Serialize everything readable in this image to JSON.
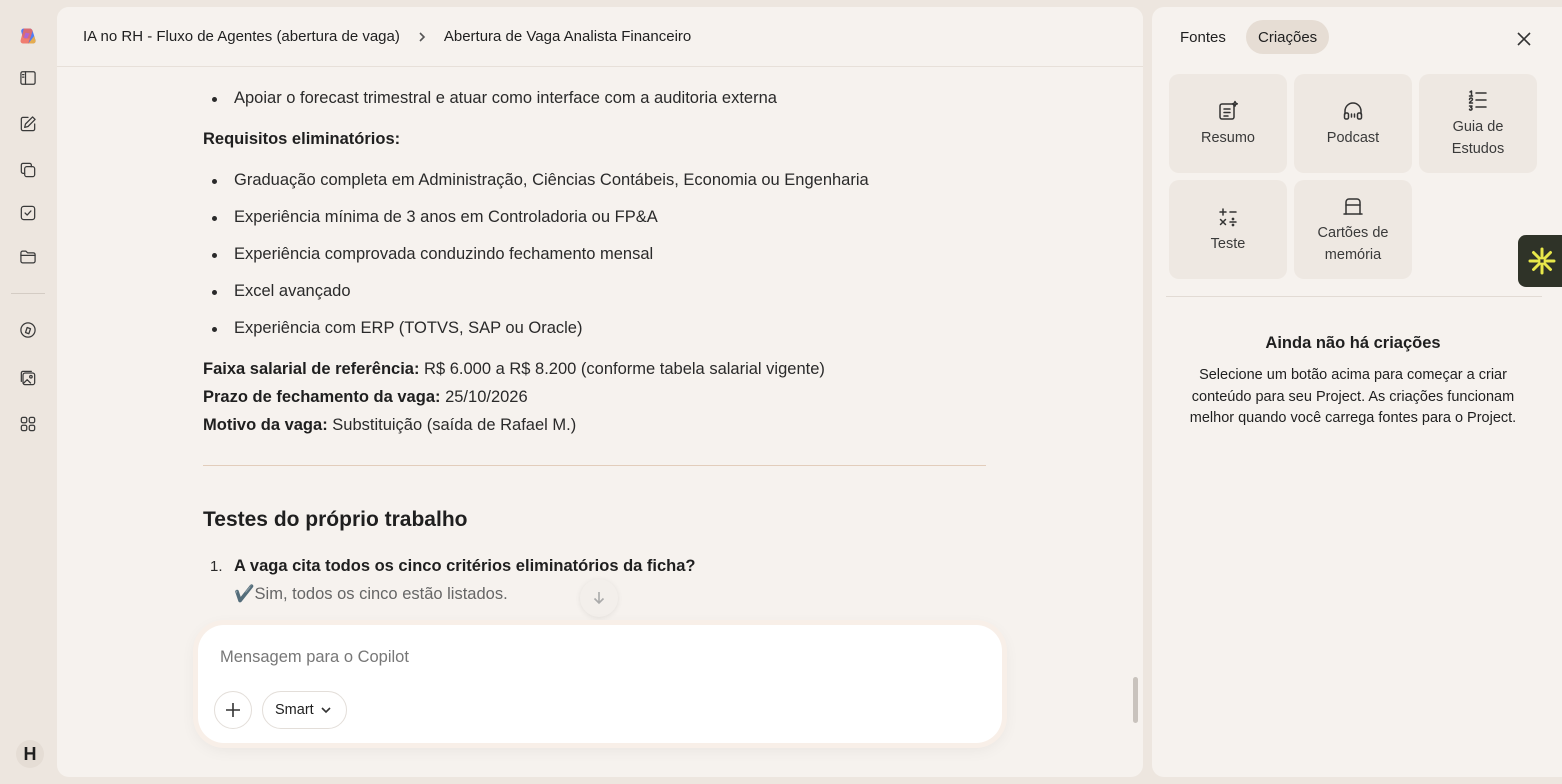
{
  "rail": {
    "avatar_initial": "H"
  },
  "header": {
    "project": "IA no RH - Fluxo de Agentes (abertura de vaga)",
    "page": "Abertura de Vaga Analista Financeiro"
  },
  "content": {
    "top_bullet": "Apoiar o forecast trimestral e atuar como interface com a auditoria externa",
    "requirements_heading": "Requisitos eliminatórios:",
    "requirements": [
      "Graduação completa em Administração, Ciências Contábeis, Economia ou Engenharia",
      "Experiência mínima de 3 anos em Controladoria ou FP&A",
      "Experiência comprovada conduzindo fechamento mensal",
      "Excel avançado",
      "Experiência com ERP (TOTVS, SAP ou Oracle)"
    ],
    "salary_label": "Faixa salarial de referência:",
    "salary_value": " R$ 6.000 a R$ 8.200 (conforme tabela salarial vigente)",
    "deadline_label": "Prazo de fechamento da vaga:",
    "deadline_value": " 25/10/2026",
    "reason_label": "Motivo da vaga:",
    "reason_value": " Substituição (saída de Rafael M.)",
    "section_title": "Testes do próprio trabalho",
    "tests": [
      {
        "num": "1.",
        "question": "A vaga cita todos os cinco critérios eliminatórios da ficha?",
        "answer": "✔️Sim, todos os cinco estão listados."
      }
    ]
  },
  "composer": {
    "placeholder": "Mensagem para o Copilot",
    "mode_label": "Smart"
  },
  "side": {
    "tabs": [
      "Fontes",
      "Criações"
    ],
    "active_tab": "Criações",
    "cards": [
      {
        "label": "Resumo",
        "icon": "summary-icon"
      },
      {
        "label": "Podcast",
        "icon": "headphones-icon"
      },
      {
        "label": "Guia de\nEstudos",
        "icon": "study-guide-icon"
      },
      {
        "label": "Teste",
        "icon": "quiz-icon"
      },
      {
        "label": "Cartões de\nmemória",
        "icon": "flashcards-icon"
      }
    ],
    "empty_title": "Ainda não há criações",
    "empty_text": "Selecione um botão acima para começar a criar conteúdo para seu Project. As criações funcionam melhor quando você carrega fontes para o Project."
  }
}
